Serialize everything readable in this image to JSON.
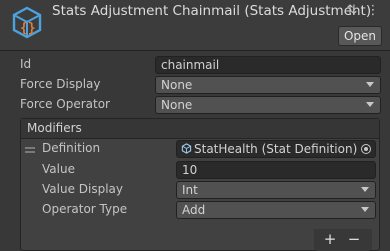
{
  "header": {
    "title": "Stats Adjustment Chainmail (Stats Adjustment)",
    "open_label": "Open",
    "icons": [
      "scriptable-object-icon",
      "preset-icon",
      "more-icon"
    ]
  },
  "fields": {
    "id": {
      "label": "Id",
      "value": "chainmail"
    },
    "force_display": {
      "label": "Force Display",
      "value": "None"
    },
    "force_operator": {
      "label": "Force Operator",
      "value": "None"
    }
  },
  "modifiers": {
    "title": "Modifiers",
    "definition": {
      "label": "Definition",
      "value": "StatHealth (Stat Definition)"
    },
    "value": {
      "label": "Value",
      "value": "10"
    },
    "value_display": {
      "label": "Value Display",
      "value": "Int"
    },
    "operator_type": {
      "label": "Operator Type",
      "value": "Add"
    }
  },
  "footer": {
    "add_label": "+",
    "remove_label": "−"
  },
  "colors": {
    "background": "#383838",
    "field": "#2a2a2a",
    "dropdown": "#515151",
    "accent_icon": "#4aa3df",
    "brace": "#e07b39"
  }
}
